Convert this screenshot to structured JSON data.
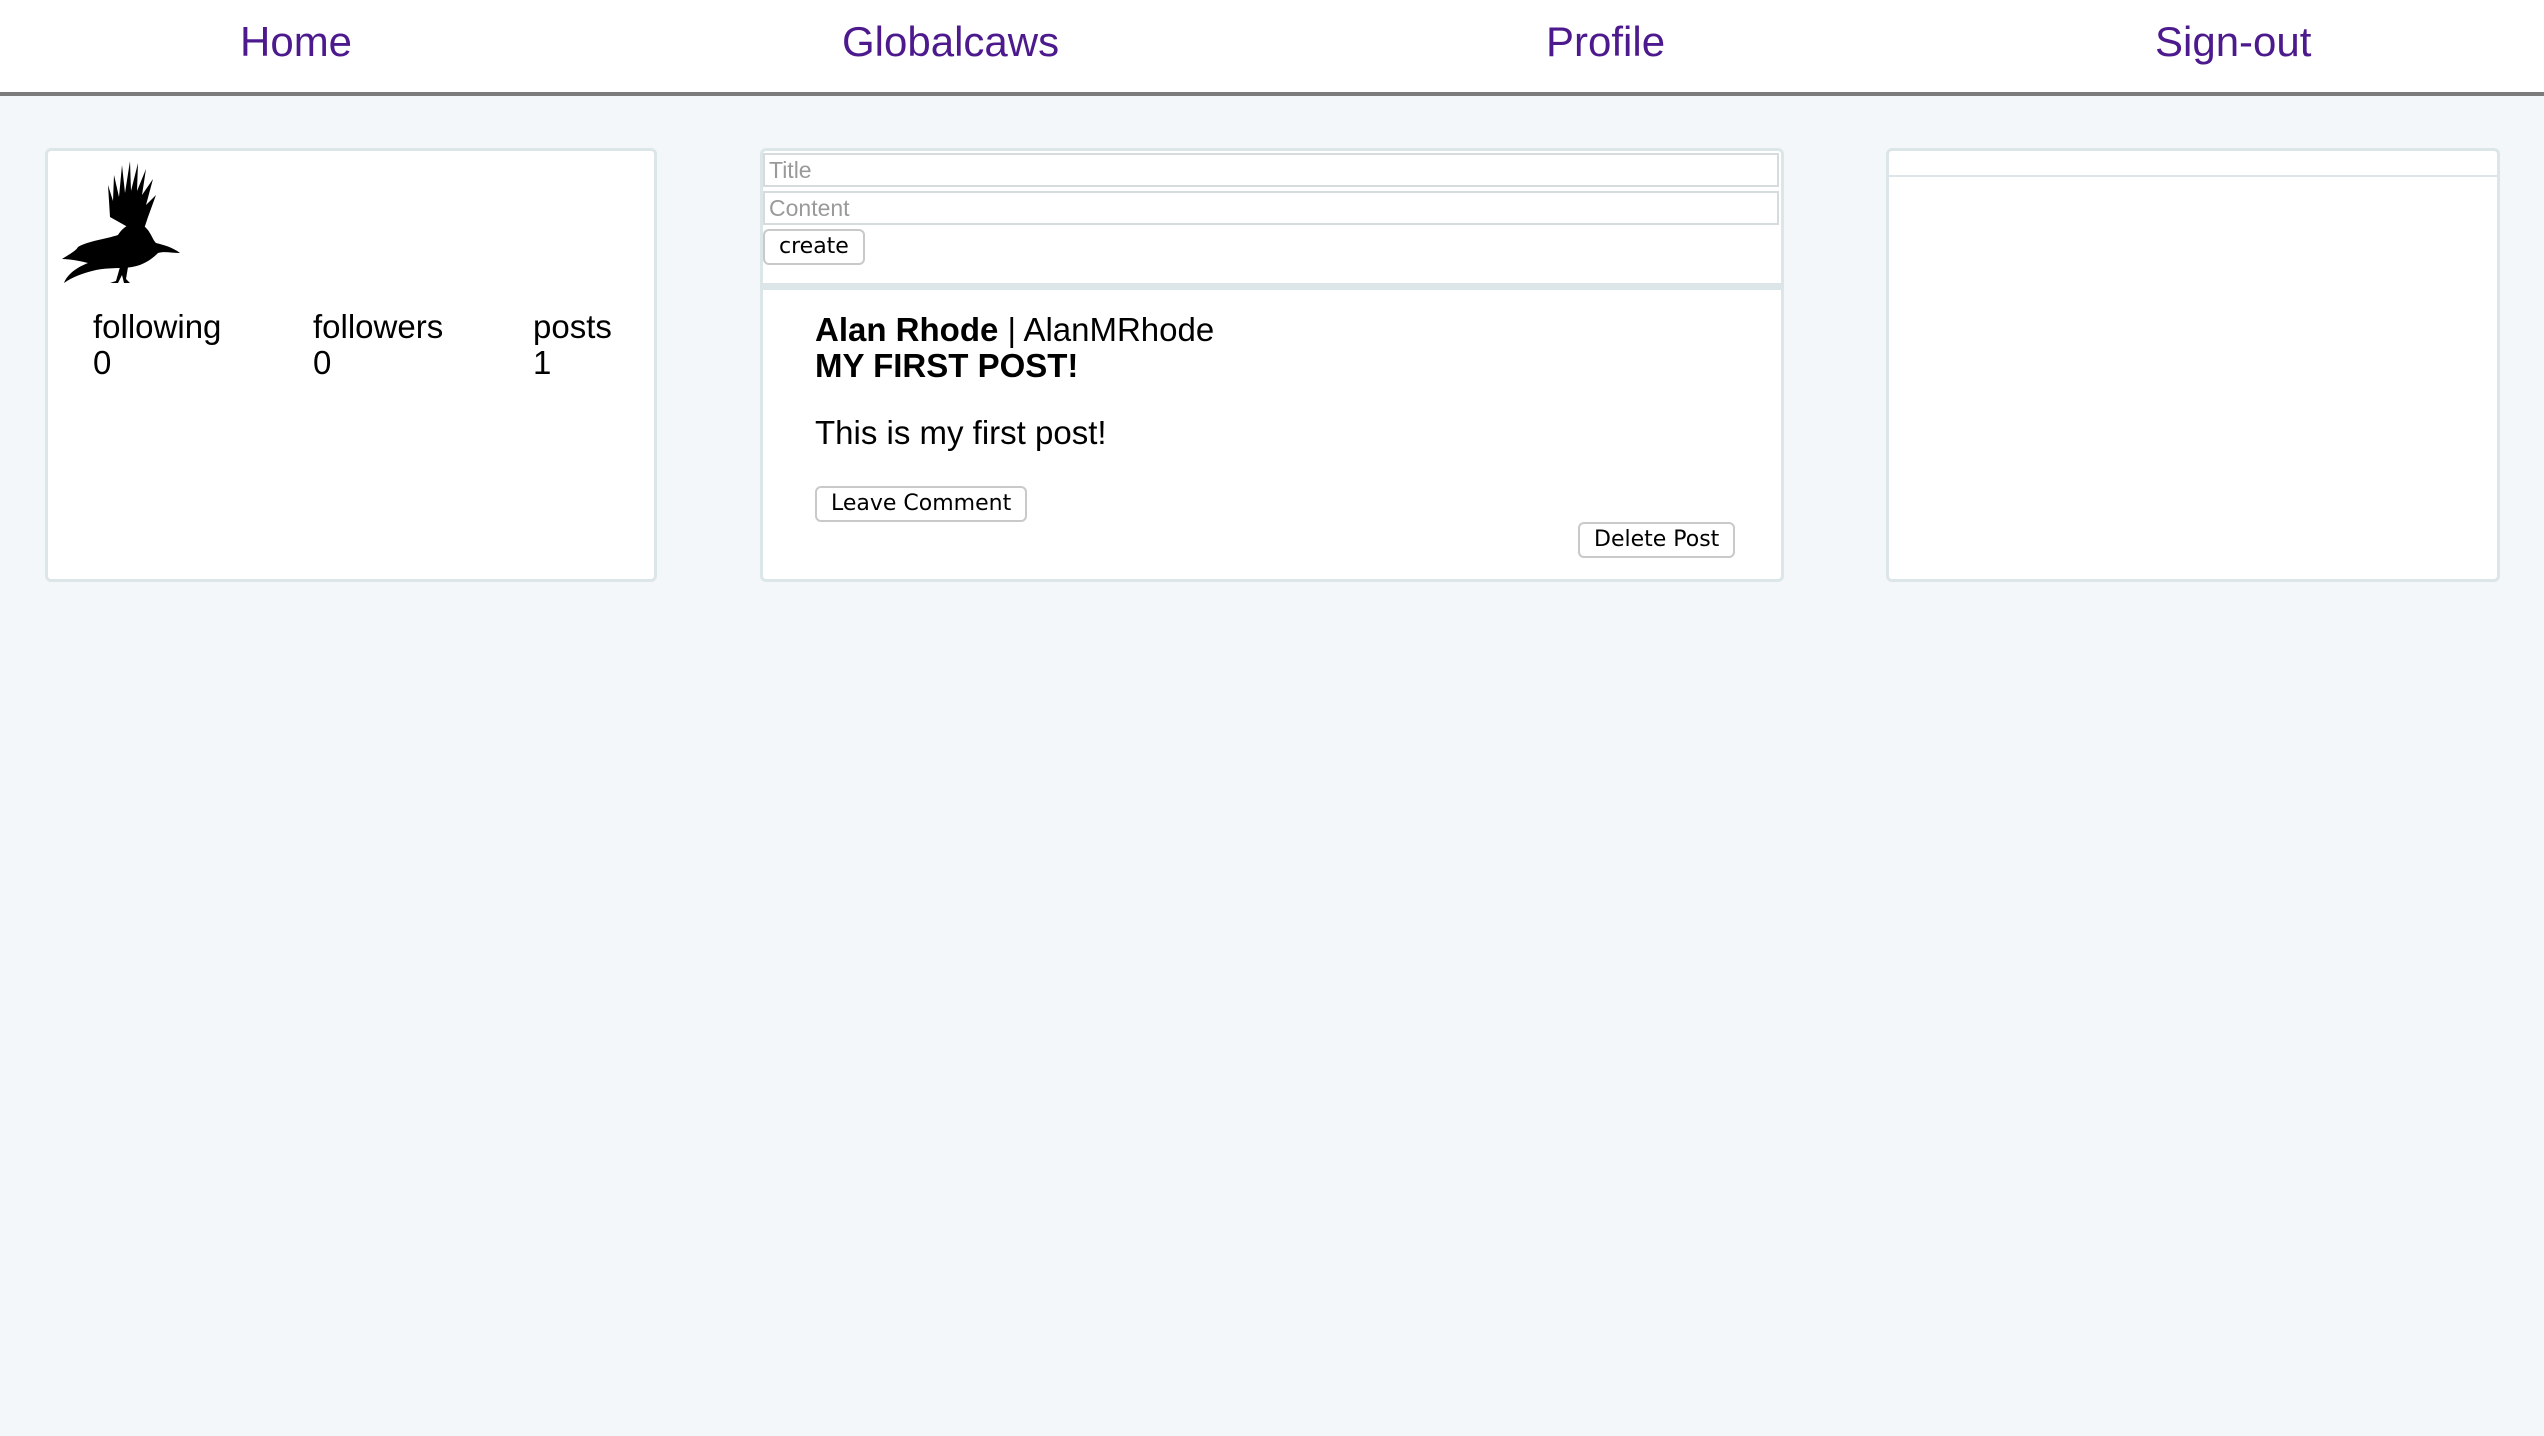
{
  "nav": {
    "home": "Home",
    "globalcaws": "Globalcaws",
    "profile": "Profile",
    "signout": "Sign-out"
  },
  "profile_card": {
    "avatar_icon": "raven-icon",
    "stats": [
      {
        "label": "following",
        "value": "0"
      },
      {
        "label": "followers",
        "value": "0"
      },
      {
        "label": "posts",
        "value": "1"
      }
    ]
  },
  "create_form": {
    "title_placeholder": "Title",
    "content_placeholder": "Content",
    "create_label": "create"
  },
  "post": {
    "author_name": "Alan Rhode",
    "separator": " | ",
    "handle": "AlanMRhode",
    "title": "MY FIRST POST!",
    "body": "This is my first post!",
    "comment_label": "Leave Comment",
    "delete_label": "Delete Post"
  },
  "colors": {
    "link": "#4d1a8e",
    "background": "#f4f7f9",
    "panel_border": "#dce6e8"
  }
}
